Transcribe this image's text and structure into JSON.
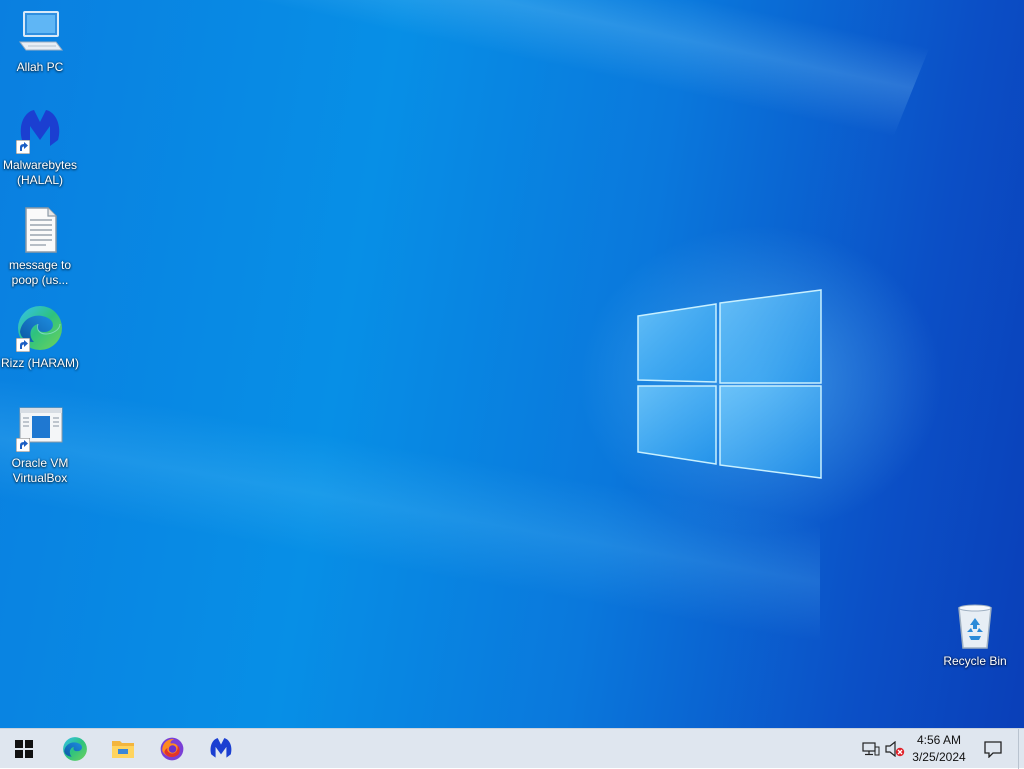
{
  "desktop": {
    "icons": [
      {
        "label_line1": "Allah PC",
        "label_line2": "",
        "icon": "computer-icon"
      },
      {
        "label_line1": "Malwarebytes",
        "label_line2": "(HALAL)",
        "icon": "malwarebytes-icon"
      },
      {
        "label_line1": "message to",
        "label_line2": "poop (us...",
        "icon": "text-document-icon"
      },
      {
        "label_line1": "Rizz (HARAM)",
        "label_line2": "",
        "icon": "edge-browser-icon"
      },
      {
        "label_line1": "Oracle VM",
        "label_line2": "VirtualBox",
        "icon": "virtualbox-icon"
      },
      {
        "label_line1": "Recycle Bin",
        "label_line2": "",
        "icon": "recycle-bin-icon"
      }
    ]
  },
  "taskbar": {
    "pinned": [
      "start-windows-icon",
      "edge-browser-icon",
      "file-explorer-icon",
      "firefox-icon",
      "malwarebytes-icon"
    ],
    "tray": [
      "network-icon",
      "volume-muted-icon"
    ],
    "clock": {
      "time": "4:56 AM",
      "date": "3/25/2024"
    },
    "notification_icon": "notification-center-icon"
  },
  "colors": {
    "taskbar_bg": "#dfe6ef",
    "desktop_blue": "#0a7fe0",
    "malwarebytes_blue": "#1b3fd1"
  }
}
